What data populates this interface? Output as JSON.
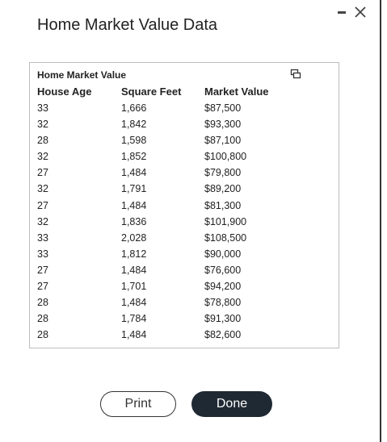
{
  "window": {
    "title": "Home Market Value Data"
  },
  "table": {
    "caption": "Home Market Value",
    "columns": [
      "House Age",
      "Square Feet",
      "Market Value"
    ],
    "rows": [
      [
        "33",
        "1,666",
        "$87,500"
      ],
      [
        "32",
        "1,842",
        "$93,300"
      ],
      [
        "28",
        "1,598",
        "$87,100"
      ],
      [
        "32",
        "1,852",
        "$100,800"
      ],
      [
        "27",
        "1,484",
        "$79,800"
      ],
      [
        "32",
        "1,791",
        "$89,200"
      ],
      [
        "27",
        "1,484",
        "$81,300"
      ],
      [
        "32",
        "1,836",
        "$101,900"
      ],
      [
        "33",
        "2,028",
        "$108,500"
      ],
      [
        "33",
        "1,812",
        "$90,000"
      ],
      [
        "27",
        "1,484",
        "$76,600"
      ],
      [
        "27",
        "1,701",
        "$94,200"
      ],
      [
        "28",
        "1,484",
        "$78,800"
      ],
      [
        "28",
        "1,784",
        "$91,300"
      ],
      [
        "28",
        "1,484",
        "$82,600"
      ]
    ]
  },
  "buttons": {
    "print": "Print",
    "done": "Done"
  },
  "icons": {
    "minimize": "minimize-icon",
    "close": "close-icon",
    "copy": "copy-icon"
  }
}
